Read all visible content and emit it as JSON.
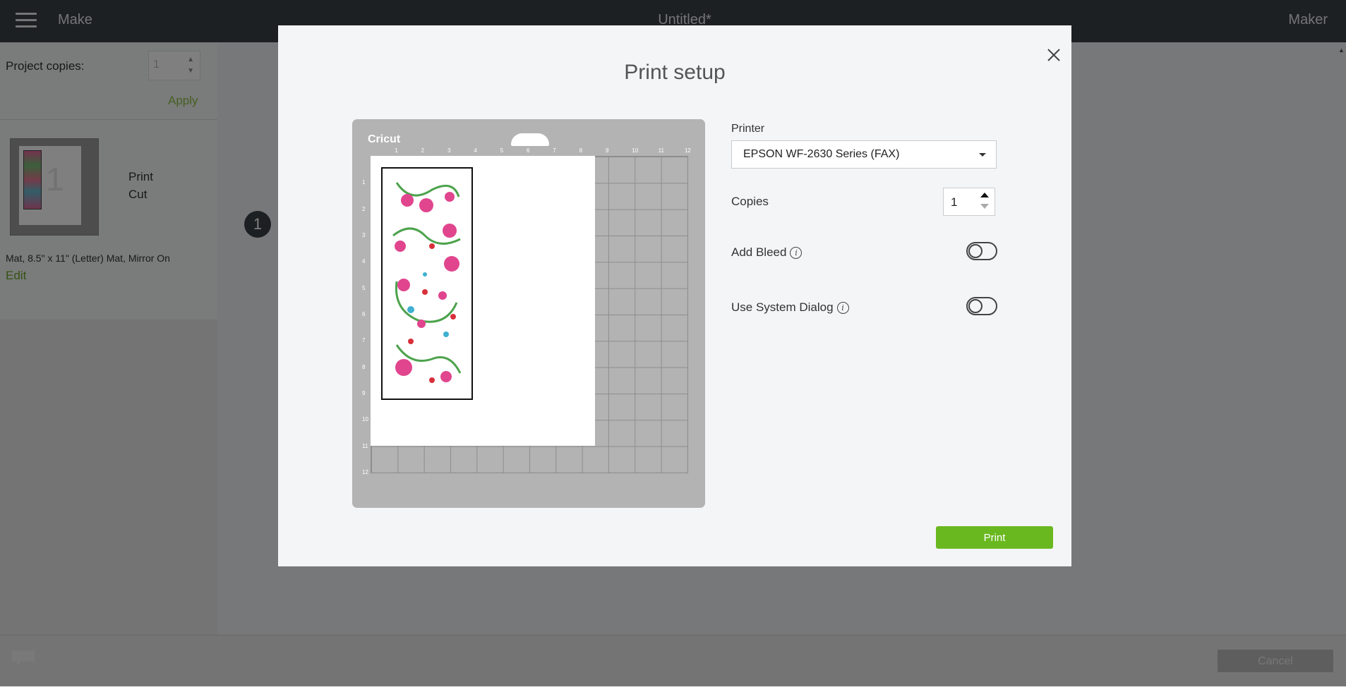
{
  "topbar": {
    "make": "Make",
    "title": "Untitled*",
    "maker": "Maker"
  },
  "left_panel": {
    "project_copies_label": "Project copies:",
    "project_copies_value": "1",
    "apply_label": "Apply",
    "thumb_number": "1",
    "print_label": "Print",
    "cut_label": "Cut",
    "mat_description": "Mat, 8.5\" x 11\" (Letter) Mat, Mirror On",
    "edit_label": "Edit",
    "step_number": "1"
  },
  "bottom_bar": {
    "cancel_label": "Cancel"
  },
  "modal": {
    "title": "Print setup",
    "mat_logo": "Cricut",
    "ruler_top": [
      "1",
      "2",
      "3",
      "4",
      "5",
      "6",
      "7",
      "8",
      "9",
      "10",
      "11",
      "12"
    ],
    "ruler_left": [
      "1",
      "2",
      "3",
      "4",
      "5",
      "6",
      "7",
      "8",
      "9",
      "10",
      "11",
      "12"
    ],
    "printer_label": "Printer",
    "printer_value": "EPSON WF-2630 Series (FAX)",
    "copies_label": "Copies",
    "copies_value": "1",
    "add_bleed_label": "Add Bleed",
    "add_bleed_on": false,
    "use_system_dialog_label": "Use System Dialog",
    "use_system_dialog_on": false,
    "print_label": "Print"
  },
  "colors": {
    "accent": "#6ab820",
    "topbar": "#3a4047"
  }
}
